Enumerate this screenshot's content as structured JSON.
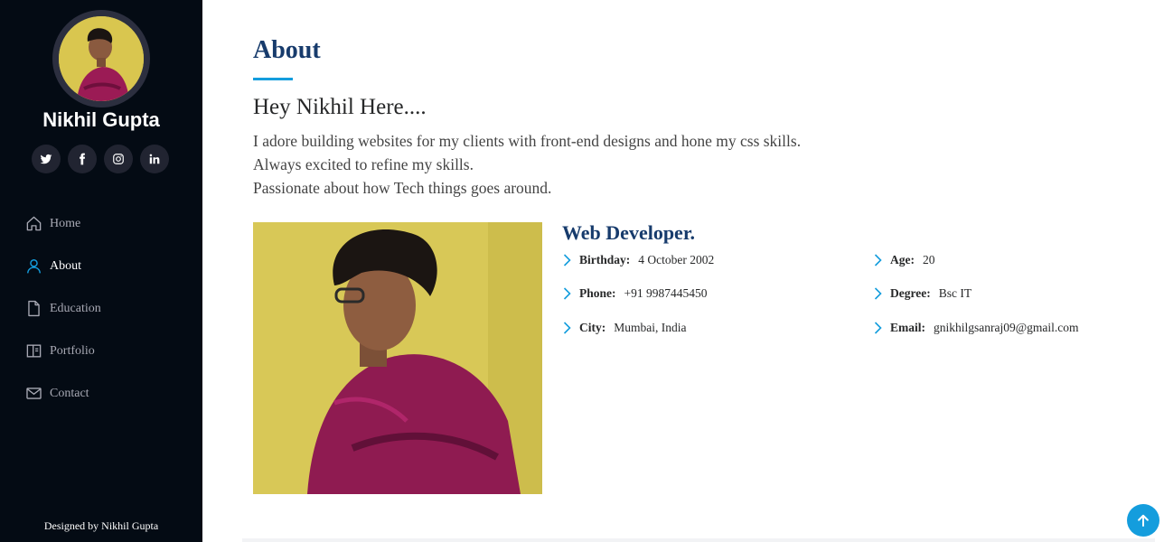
{
  "sidebar": {
    "name": "Nikhil Gupta",
    "socials": [
      "twitter-icon",
      "facebook-icon",
      "instagram-icon",
      "linkedin-icon"
    ],
    "nav": [
      {
        "label": "Home",
        "icon": "home-icon",
        "active": false
      },
      {
        "label": "About",
        "icon": "user-icon",
        "active": true
      },
      {
        "label": "Education",
        "icon": "file-icon",
        "active": false
      },
      {
        "label": "Portfolio",
        "icon": "book-icon",
        "active": false
      },
      {
        "label": "Contact",
        "icon": "envelope-icon",
        "active": false
      }
    ],
    "credit": "Designed by Nikhil Gupta"
  },
  "about": {
    "title": "About",
    "greeting": "Hey Nikhil Here....",
    "intro": [
      "I adore building websites for my clients with front-end designs and hone my css skills.",
      "Always excited to refine my skills.",
      "Passionate about how Tech things goes around."
    ],
    "role": "Web Developer.",
    "details": [
      {
        "key": "Birthday:",
        "value": "4 October 2002"
      },
      {
        "key": "Phone:",
        "value": "+91 9987445450"
      },
      {
        "key": "City:",
        "value": "Mumbai, India"
      },
      {
        "key": "Age:",
        "value": "20"
      },
      {
        "key": "Degree:",
        "value": "Bsc IT"
      },
      {
        "key": "Email:",
        "value": "gnikhilgsanraj09@gmail.com"
      }
    ]
  },
  "colors": {
    "sidebar_bg": "#040b14",
    "accent": "#149ddd",
    "heading": "#173b6c",
    "nav_text": "#a8a9b4"
  }
}
